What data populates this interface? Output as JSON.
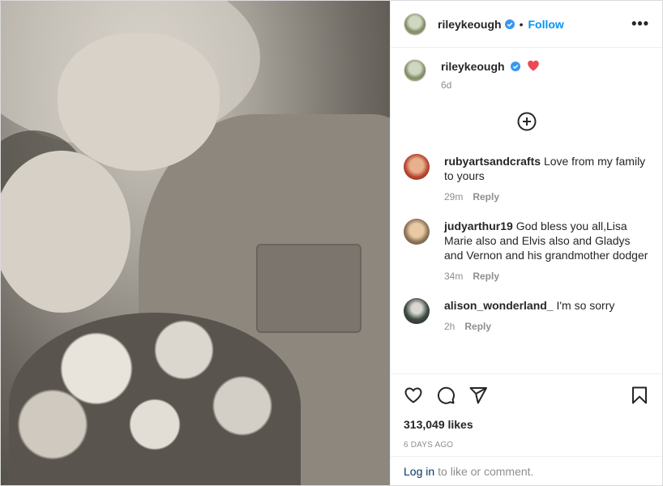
{
  "post": {
    "username": "rileykeough",
    "follow_label": "Follow",
    "separator": "•",
    "more_label": "•••"
  },
  "caption": {
    "username": "rileykeough",
    "emoji": "heart",
    "time": "6d"
  },
  "comments": [
    {
      "username": "rubyartsandcrafts",
      "text": "Love from my family to yours",
      "time": "29m",
      "reply": "Reply"
    },
    {
      "username": "judyarthur19",
      "text": "God bless you all,Lisa Marie also and Elvis also and Gladys and Vernon and his grandmother dodger",
      "time": "34m",
      "reply": "Reply"
    },
    {
      "username": "alison_wonderland_",
      "text": "I'm so sorry",
      "time": "2h",
      "reply": "Reply"
    }
  ],
  "actions": {
    "likes": "313,049 likes",
    "date": "6 DAYS AGO"
  },
  "login": {
    "link": "Log in",
    "text": "to like or comment."
  },
  "colors": {
    "accent": "#0095f6",
    "link": "#00376b",
    "muted": "#8e8e8e",
    "verified": "#3897f0",
    "heart": "#ed4956"
  },
  "icons": [
    "more-options-icon",
    "verified-badge-icon",
    "red-heart-emoji",
    "load-more-comments-icon",
    "like-icon",
    "comment-icon",
    "share-icon",
    "save-icon"
  ]
}
